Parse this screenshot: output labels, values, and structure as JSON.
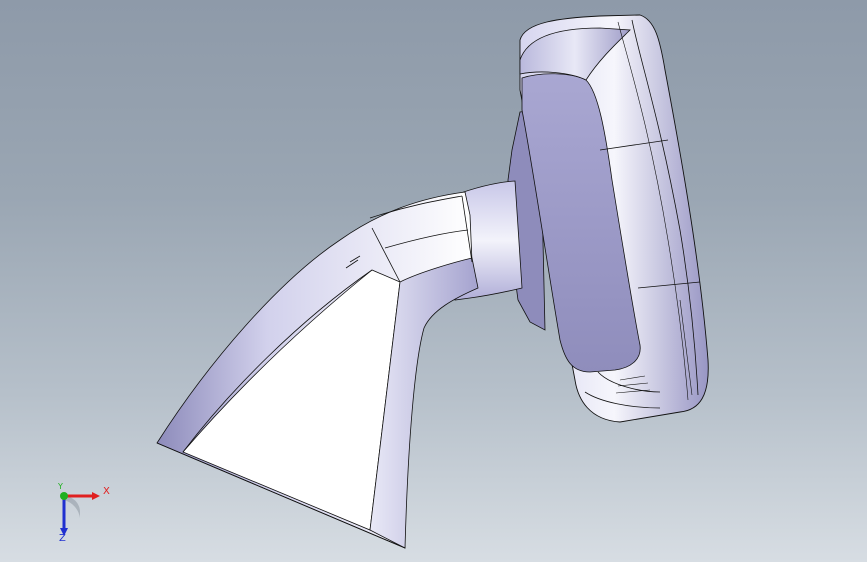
{
  "viewport": {
    "background_top": "#8e9aa9",
    "background_bottom": "#d7dde3",
    "model_color": "#c9c8e6",
    "edge_color": "#111111"
  },
  "triad": {
    "x_label": "X",
    "y_label": "Y",
    "z_label": "Z",
    "x_color": "#e02020",
    "y_color": "#20b020",
    "z_color": "#2030d0"
  }
}
